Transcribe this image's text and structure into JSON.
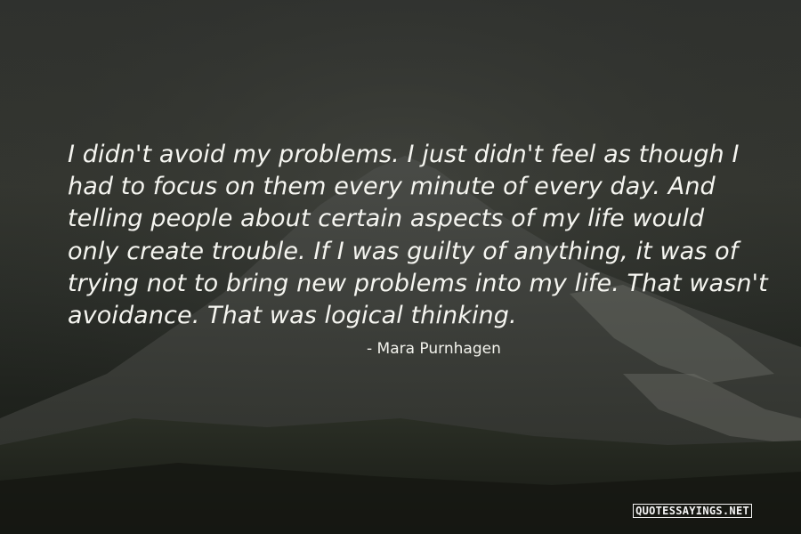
{
  "quote": {
    "lines": [
      "I didn't avoid my problems. I just didn't feel as though I",
      "had to focus on them every minute of every day. And",
      "telling people about certain aspects of my life would",
      "only create trouble. If I was guilty of anything, it was of",
      "trying not to bring new problems into my life. That wasn't",
      "avoidance. That was logical thinking."
    ],
    "author": "- Mara Purnhagen"
  },
  "watermark": "QUOTESSAYINGS.NET",
  "colors": {
    "text": "#f5f5f0",
    "background": "#2e302b"
  }
}
